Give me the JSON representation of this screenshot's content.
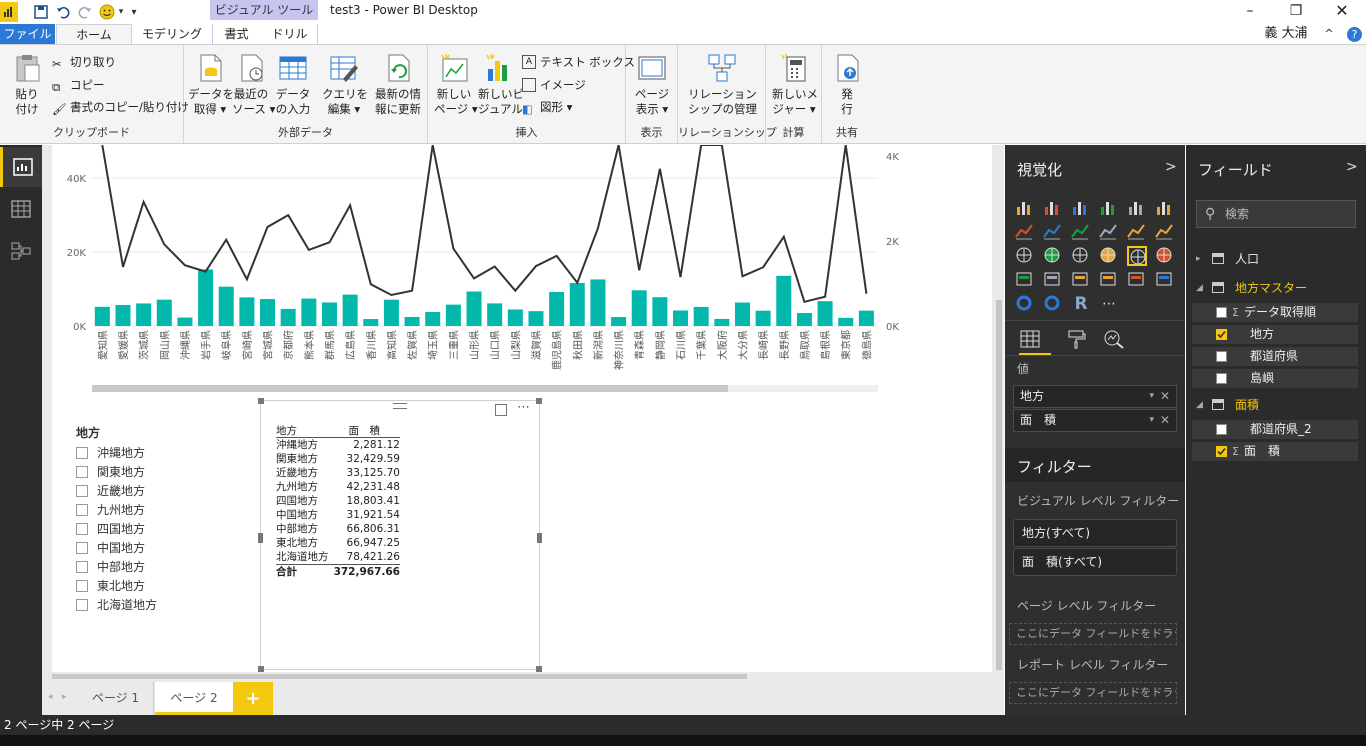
{
  "window": {
    "title": "test3 - Power BI Desktop",
    "contextual_tab": "ビジュアル ツール",
    "user": "義 大浦"
  },
  "ribbon_tabs": [
    "ファイル",
    "ホーム",
    "モデリング",
    "書式",
    "ドリル"
  ],
  "ribbon": {
    "clipboard": {
      "paste": "貼り\n付け",
      "cut": "切り取り",
      "copy": "コピー",
      "format_painter": "書式のコピー/貼り付け",
      "label": "クリップボード"
    },
    "external": {
      "get_data": "データを\n取得 ▾",
      "recent": "最近の\nソース ▾",
      "enter_data": "データ\nの入力",
      "edit_queries": "クエリを\n編集 ▾",
      "refresh": "最新の情\n報に更新",
      "label": "外部データ"
    },
    "insert": {
      "new_page": "新しい\nページ ▾",
      "new_visual": "新しいビ\nジュアル",
      "text_box": "テキスト ボックス",
      "image": "イメージ",
      "shapes": "図形 ▾",
      "label": "挿入"
    },
    "view": {
      "page_view": "ページ\n表示 ▾",
      "label": "表示"
    },
    "relationships": {
      "manage": "リレーション\nシップの管理",
      "label": "リレーションシップ"
    },
    "calc": {
      "new_measure": "新しいメ\nジャー ▾",
      "label": "計算"
    },
    "share": {
      "publish": "発\n行",
      "label": "共有"
    }
  },
  "chart_data": {
    "type": "bar",
    "categories": [
      "愛知県",
      "愛媛県",
      "茨城県",
      "岡山県",
      "沖縄県",
      "岩手県",
      "岐阜県",
      "宮崎県",
      "宮城県",
      "京都府",
      "熊本県",
      "群馬県",
      "広島県",
      "香川県",
      "高知県",
      "佐賀県",
      "埼玉県",
      "三重県",
      "山形県",
      "山口県",
      "山梨県",
      "滋賀県",
      "鹿児島県",
      "秋田県",
      "新潟県",
      "神奈川県",
      "青森県",
      "静岡県",
      "石川県",
      "千葉県",
      "大阪府",
      "大分県",
      "長崎県",
      "長野県",
      "鳥取県",
      "島根県",
      "東京都",
      "徳島県"
    ],
    "series": [
      {
        "name": "面 積",
        "axis": "left",
        "type": "bar",
        "color": "#01b8aa",
        "values": [
          5173,
          5676,
          6097,
          7114,
          2281,
          15275,
          10621,
          7735,
          7282,
          4612,
          7409,
          6362,
          8479,
          1877,
          7104,
          2441,
          3798,
          5774,
          9323,
          6113,
          4465,
          4017,
          9187,
          11638,
          12584,
          2416,
          9645,
          7777,
          4186,
          5158,
          1905,
          6341,
          4132,
          13562,
          3507,
          6708,
          2191,
          4147
        ]
      },
      {
        "name": "人口",
        "axis": "right",
        "type": "line",
        "color": "#333333",
        "values": [
          7480,
          1390,
          2920,
          1920,
          1430,
          1280,
          2030,
          1100,
          2330,
          2610,
          1790,
          1970,
          2840,
          980,
          730,
          830,
          7270,
          1820,
          1120,
          1400,
          830,
          1410,
          1650,
          1020,
          2300,
          9130,
          1310,
          3700,
          1150,
          6220,
          8840,
          1170,
          1380,
          2100,
          570,
          690,
          13520,
          760
        ]
      }
    ],
    "left_axis": {
      "ticks": [
        "0K",
        "20K",
        "40K"
      ],
      "range": [
        0,
        40000
      ]
    },
    "right_axis": {
      "ticks": [
        "0K",
        "2K",
        "4K"
      ],
      "range": [
        0,
        4000
      ]
    }
  },
  "slicer": {
    "title": "地方",
    "items": [
      "沖縄地方",
      "関東地方",
      "近畿地方",
      "九州地方",
      "四国地方",
      "中国地方",
      "中部地方",
      "東北地方",
      "北海道地方"
    ]
  },
  "table": {
    "headers": [
      "地方",
      "面　積"
    ],
    "rows": [
      [
        "沖縄地方",
        "2,281.12"
      ],
      [
        "関東地方",
        "32,429.59"
      ],
      [
        "近畿地方",
        "33,125.70"
      ],
      [
        "九州地方",
        "42,231.48"
      ],
      [
        "四国地方",
        "18,803.41"
      ],
      [
        "中国地方",
        "31,921.54"
      ],
      [
        "中部地方",
        "66,806.31"
      ],
      [
        "東北地方",
        "66,947.25"
      ],
      [
        "北海道地方",
        "78,421.26"
      ]
    ],
    "total": [
      "合計",
      "372,967.66"
    ]
  },
  "page_tabs": [
    "ページ 1",
    "ページ 2",
    "+"
  ],
  "status": "2 ページ中 2 ページ",
  "viz_pane": {
    "title": "視覚化",
    "values_label": "値",
    "wells": [
      "地方",
      "面　積"
    ],
    "filters_title": "フィルター",
    "visual_filters_label": "ビジュアル レベル フィルター",
    "visual_filters": [
      "地方(すべて)",
      "面　積(すべて)"
    ],
    "page_filters_label": "ページ レベル フィルター",
    "report_filters_label": "レポート レベル フィルター",
    "drop_placeholder": "ここにデータ フィールドをドラッグ..."
  },
  "field_pane": {
    "title": "フィールド",
    "search_placeholder": "検索",
    "tables": [
      {
        "name": "人口",
        "expanded": false
      },
      {
        "name": "地方マスター",
        "expanded": true,
        "fields": [
          {
            "name": "データ取得順",
            "checked": false,
            "sigma": true
          },
          {
            "name": "地方",
            "checked": true,
            "sigma": false
          },
          {
            "name": "都道府県",
            "checked": false,
            "sigma": false
          },
          {
            "name": "島嶼",
            "checked": false,
            "sigma": false
          }
        ]
      },
      {
        "name": "面積",
        "expanded": true,
        "fields": [
          {
            "name": "都道府県_2",
            "checked": false,
            "sigma": false
          },
          {
            "name": "面　積",
            "checked": true,
            "sigma": true
          }
        ]
      }
    ]
  },
  "colors": {
    "accent": "#f2c811",
    "bar": "#01b8aa",
    "file_tab": "#2b79d4"
  }
}
